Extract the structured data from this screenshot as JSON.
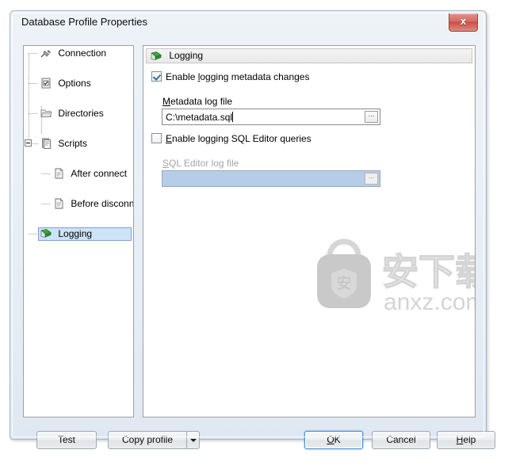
{
  "window": {
    "title": "Database Profile Properties",
    "close_label": "x",
    "close_icon": "close-icon"
  },
  "tree": {
    "items": [
      {
        "label": "Connection",
        "icon": "plug-connection-icon",
        "level": 0,
        "selected": false,
        "expander": null
      },
      {
        "label": "Options",
        "icon": "options-checkbox-page-icon",
        "level": 0,
        "selected": false,
        "expander": null
      },
      {
        "label": "Directories",
        "icon": "folder-icon",
        "level": 0,
        "selected": false,
        "expander": null
      },
      {
        "label": "Scripts",
        "icon": "scripts-pages-icon",
        "level": 0,
        "selected": false,
        "expander": "collapse"
      },
      {
        "label": "After connect",
        "icon": "script-page-icon",
        "level": 1,
        "selected": false,
        "expander": null
      },
      {
        "label": "Before disconnec",
        "icon": "script-page-icon",
        "level": 1,
        "selected": false,
        "expander": null
      },
      {
        "label": "Logging",
        "icon": "logging-green-book-icon",
        "level": 0,
        "selected": true,
        "expander": null
      }
    ]
  },
  "panel": {
    "header": {
      "title": "Logging",
      "icon": "logging-green-book-icon"
    },
    "metadata": {
      "checkbox": {
        "label_before": "Enable ",
        "label_accel": "l",
        "label_after": "ogging metadata changes",
        "checked": true
      },
      "field_label_accel": "M",
      "field_label_rest": "etadata log file",
      "value": "C:\\metadata.sql",
      "browse_label": "...",
      "enabled": true
    },
    "sqleditor": {
      "checkbox": {
        "label_accel": "E",
        "label_after": "nable logging SQL Editor queries",
        "checked": false
      },
      "field_label_accel": "S",
      "field_label_rest": "QL Editor log file",
      "value": "",
      "browse_label": "...",
      "enabled": false
    }
  },
  "watermark": {
    "text_cn": "安下载",
    "text_domain": "anxz.com",
    "badge_char": "安",
    "color": "#d8d8d8"
  },
  "footer": {
    "test": "Test",
    "copy_profile": "Copy profile",
    "copy_profile_arrow": "dropdown-arrow",
    "ok_accel": "O",
    "ok_rest": "K",
    "cancel": "Cancel",
    "help_accel": "H",
    "help_rest": "elp"
  },
  "colors": {
    "selection": "#cde3f7",
    "disabled_field": "#b6cde8",
    "accent_default_button": "#4c8fd1",
    "close_button": "#c84e44"
  }
}
